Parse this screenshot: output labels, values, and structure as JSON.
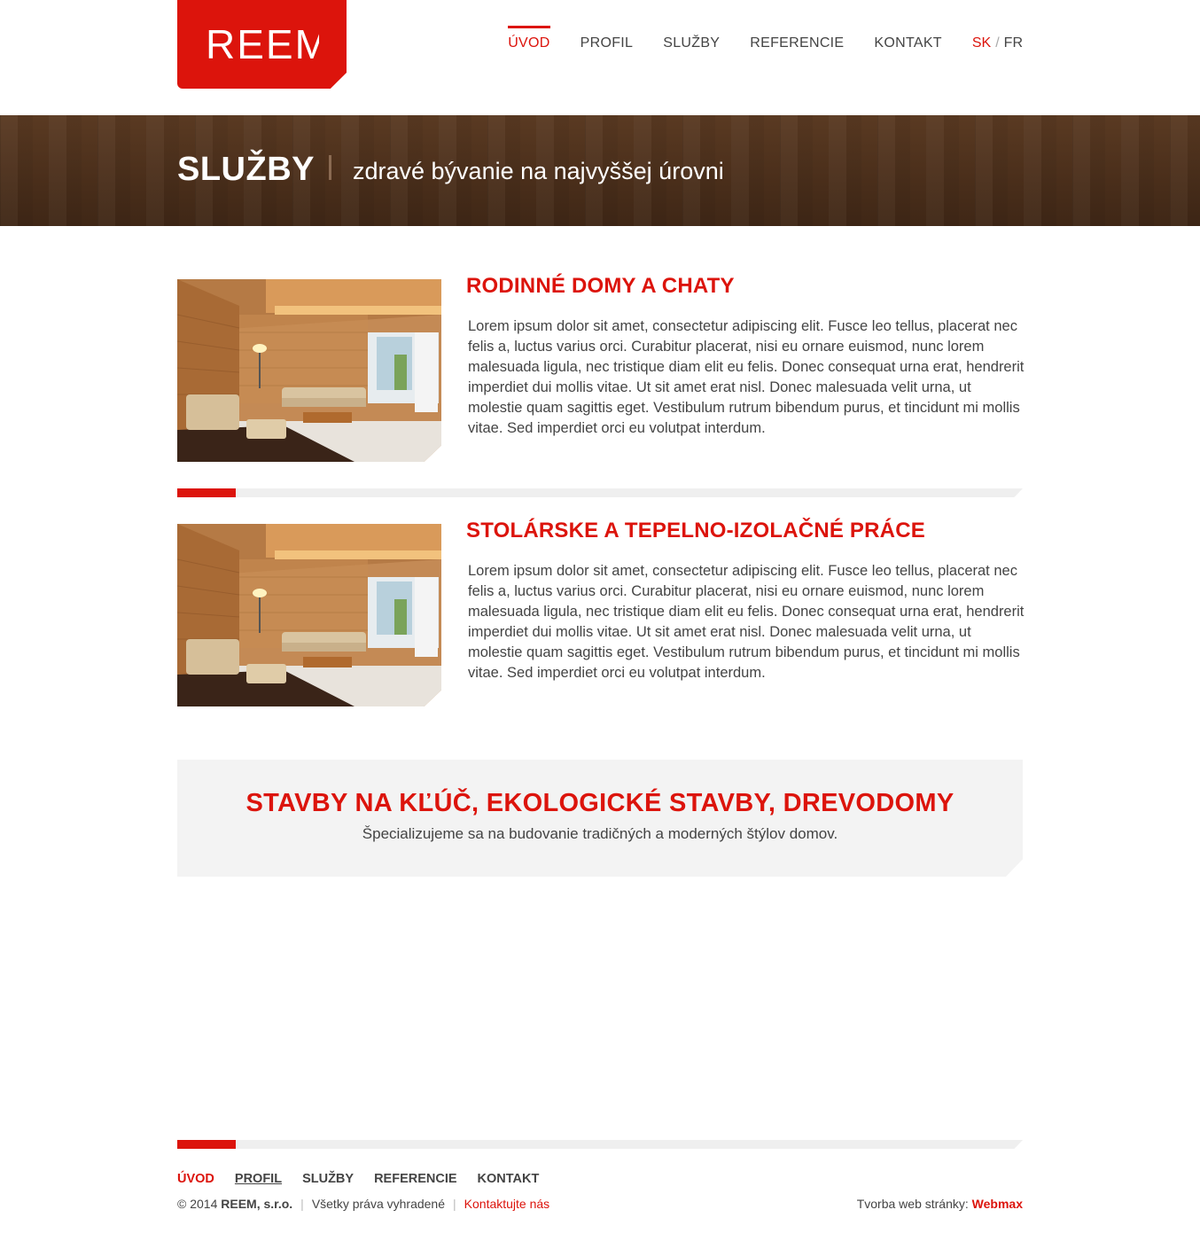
{
  "header": {
    "logo_text": "REEM",
    "nav": [
      "ÚVOD",
      "PROFIL",
      "SLUŽBY",
      "REFERENCIE",
      "KONTAKT"
    ],
    "active_nav": "ÚVOD",
    "lang": {
      "sk": "SK",
      "separator": "/",
      "fr": "FR"
    }
  },
  "banner": {
    "title": "SLUŽBY",
    "subtitle": "zdravé bývanie na najvyššej úrovni"
  },
  "services": [
    {
      "title": "RODINNÉ DOMY A CHATY",
      "text": "Lorem ipsum dolor sit amet, consectetur adipiscing elit. Fusce leo tellus, placerat nec felis a, luctus varius orci. Curabitur placerat, nisi eu ornare euismod, nunc lorem malesuada ligula, nec tristique diam elit eu felis. Donec consequat urna erat, hendrerit imperdiet dui mollis vitae. Ut sit amet erat nisl. Donec malesuada velit urna, ut molestie quam sagittis eget. Vestibulum rutrum bibendum purus, et tincidunt mi mollis vitae. Sed imperdiet orci eu volutpat interdum."
    },
    {
      "title": "STOLÁRSKE A TEPELNO-IZOLAČNÉ PRÁCE",
      "text": "Lorem ipsum dolor sit amet, consectetur adipiscing elit. Fusce leo tellus, placerat nec felis a, luctus varius orci. Curabitur placerat, nisi eu ornare euismod, nunc lorem malesuada ligula, nec tristique diam elit eu felis. Donec consequat urna erat, hendrerit imperdiet dui mollis vitae. Ut sit amet erat nisl. Donec malesuada velit urna, ut molestie quam sagittis eget. Vestibulum rutrum bibendum purus, et tincidunt mi mollis vitae. Sed imperdiet orci eu volutpat interdum."
    }
  ],
  "cta": {
    "title": "STAVBY NA KĽÚČ, EKOLOGICKÉ STAVBY, DREVODOMY",
    "text": "Špecializujeme sa na budovanie tradičných a moderných štýlov domov."
  },
  "footer": {
    "nav": [
      "ÚVOD",
      "PROFIL",
      "SLUŽBY",
      "REFERENCIE",
      "KONTAKT"
    ],
    "copyright": "© 2014",
    "company": "REEM, s.r.o.",
    "rights": "Všetky práva vyhradené",
    "contact_link": "Kontaktujte nás",
    "credit_label": "Tvorba web stránky:",
    "credit_brand": "Webmax"
  },
  "colors": {
    "accent": "#dc140c",
    "text": "#444444",
    "panel": "#f3f3f3",
    "wood": "#4b2f1b"
  }
}
